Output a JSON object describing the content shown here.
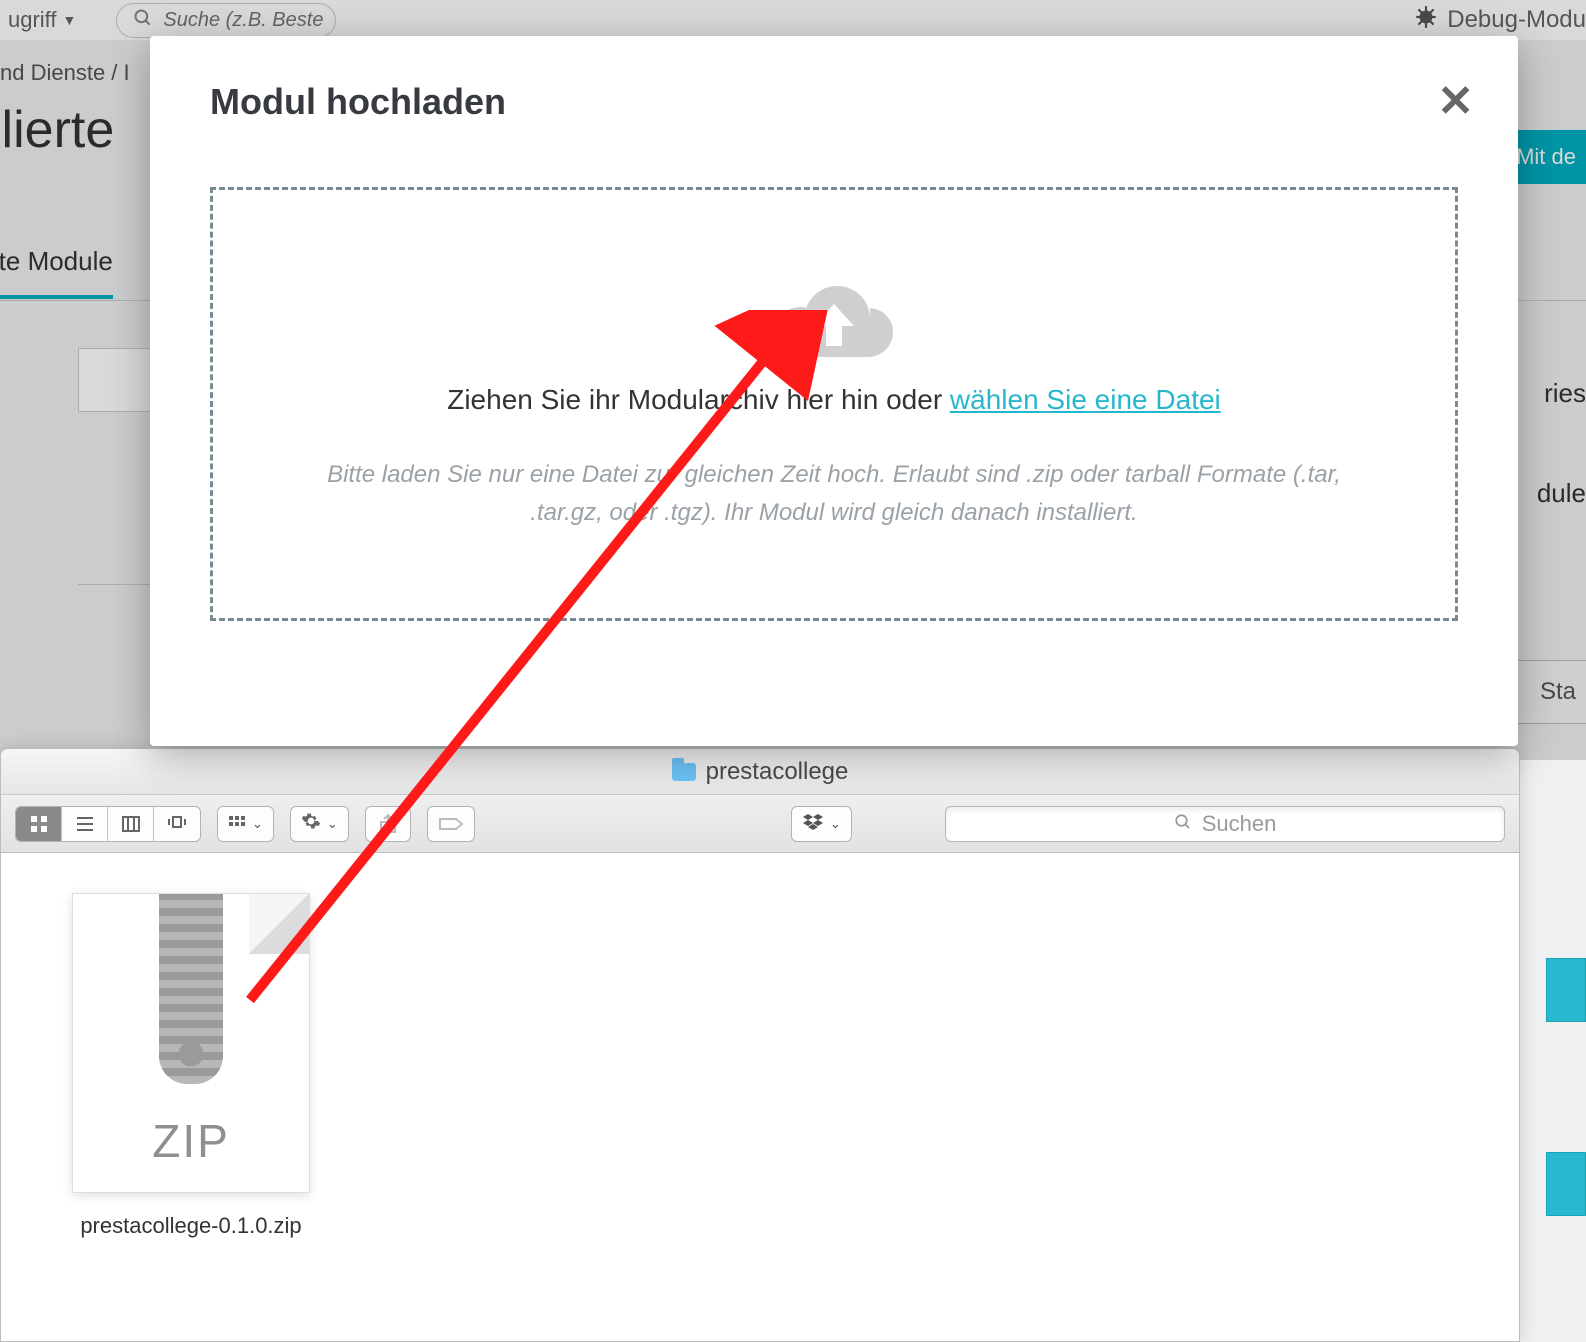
{
  "bg": {
    "dropdown_label": "ugriff",
    "search_placeholder": "Suche (z.B. Bestell-Nr., K",
    "debug_label": "Debug-Modu",
    "breadcrumb_frag": "nd Dienste  /   I",
    "title_frag": "llierte",
    "connect_frag": "Mit de",
    "tab_frag": "rte Module",
    "right_frag1": "ries",
    "right_frag2": "dule",
    "btn_frag": "Sta"
  },
  "modal": {
    "title": "Modul hochladen",
    "line_prefix": "Ziehen Sie ihr Modularchiv hier hin oder ",
    "line_link": "wählen Sie eine Datei",
    "hint": "Bitte laden Sie nur eine Datei zur gleichen Zeit hoch. Erlaubt sind .zip oder tarball Formate (.tar, .tar.gz, oder .tgz). Ihr Modul wird gleich danach installiert."
  },
  "finder": {
    "folder_name": "prestacollege",
    "search_placeholder": "Suchen",
    "file_name": "prestacollege-0.1.0.zip",
    "zip_badge": "ZIP"
  }
}
